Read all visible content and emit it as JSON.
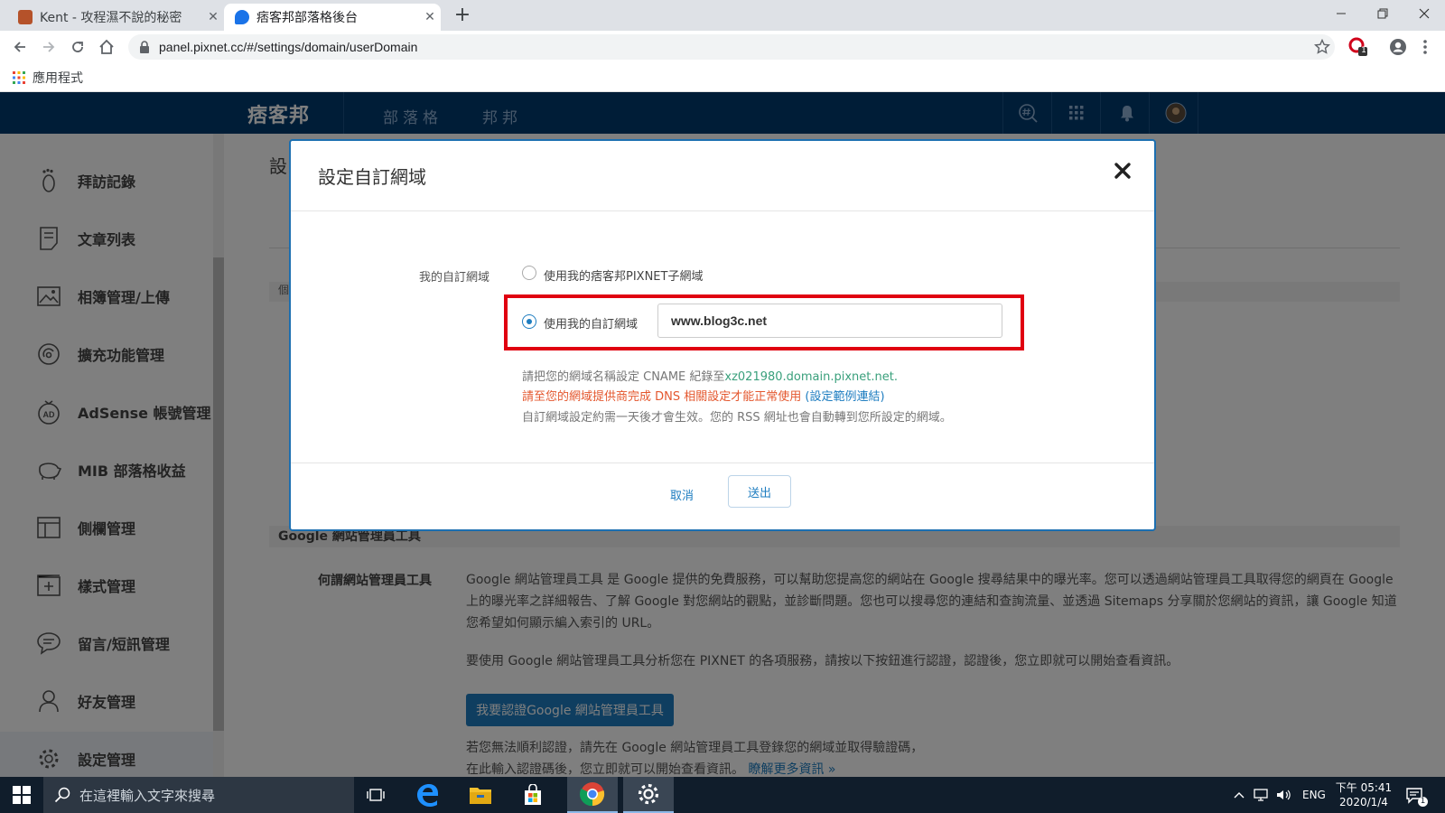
{
  "browser": {
    "tabs": [
      {
        "title": "Kent - 攻程濕不說的秘密",
        "favicon": "blog-favicon",
        "active": false
      },
      {
        "title": "痞客邦部落格後台",
        "favicon": "pixnet-favicon",
        "active": true
      }
    ],
    "url": "panel.pixnet.cc/#/settings/domain/userDomain",
    "bookmarks_label": "應用程式",
    "extension_badge": "1"
  },
  "site_header": {
    "logo": "痞客邦",
    "nav": [
      "部落格",
      "邦邦"
    ],
    "icons": [
      "search-hashtag-icon",
      "apps-grid-icon",
      "bell-icon",
      "avatar"
    ],
    "bg_color": "#003b6f"
  },
  "sidebar": {
    "items": [
      {
        "label": "拜訪記錄",
        "icon": "footprint-icon"
      },
      {
        "label": "文章列表",
        "icon": "document-icon"
      },
      {
        "label": "相簿管理/上傳",
        "icon": "image-icon"
      },
      {
        "label": "擴充功能管理",
        "icon": "plugin-icon"
      },
      {
        "label": "AdSense 帳號管理",
        "icon": "adsense-icon"
      },
      {
        "label": "MIB 部落格收益",
        "icon": "piggy-bank-icon"
      },
      {
        "label": "側欄管理",
        "icon": "sidebar-layout-icon"
      },
      {
        "label": "樣式管理",
        "icon": "style-icon"
      },
      {
        "label": "留言/短訊管理",
        "icon": "chat-icon"
      },
      {
        "label": "好友管理",
        "icon": "friend-icon"
      },
      {
        "label": "設定管理",
        "icon": "gear-icon",
        "active": true
      }
    ]
  },
  "main": {
    "title_partial": "設",
    "band_partial": "個",
    "google_section": "Google 網站管理員工具",
    "google_question": "何謂網站管理員工具",
    "google_desc": "Google 網站管理員工具 是 Google 提供的免費服務，可以幫助您提高您的網站在 Google 搜尋結果中的曝光率。您可以透過網站管理員工具取得您的網頁在 Google 上的曝光率之詳細報告、了解 Google 對您網站的觀點，並診斷問題。您也可以搜尋您的連結和查詢流量、並透過 Sitemaps 分享關於您網站的資訊，讓 Google 知道您希望如何顯示編入索引的 URL。",
    "google_usage": "要使用 Google 網站管理員工具分析您在 PIXNET 的各項服務，請按以下按鈕進行認證，認證後，您立即就可以開始查看資訊。",
    "google_button": "我要認證Google 網站管理員工具",
    "google_note1": "若您無法順利認證，請先在 Google 網站管理員工具登錄您的網域並取得驗證碼，",
    "google_note2": "在此輸入認證碼後，您立即就可以開始查看資訊。",
    "google_more": "瞭解更多資訊 »"
  },
  "modal": {
    "title": "設定自訂網域",
    "field_label": "我的自訂網域",
    "option_pixnet": "使用我的痞客邦PIXNET子網域",
    "option_custom": "使用我的自訂網域",
    "selected_option": "custom",
    "domain_value": "www.blog3c.net",
    "hint_cname_prefix": "請把您的網域名稱設定 CNAME 紀錄至",
    "hint_cname_target": "xz021980.domain.pixnet.net.",
    "hint_dns": "請至您的網域提供商完成 DNS 相關設定才能正常使用",
    "hint_dns_link": "(設定範例連結)",
    "hint_delay": "自訂網域設定約需一天後才會生效。您的 RSS 網址也會自動轉到您所設定的網域。",
    "cancel_label": "取消",
    "submit_label": "送出",
    "highlight_color": "#e00010",
    "accent_color": "#1e7dc0"
  },
  "taskbar": {
    "search_placeholder": "在這裡輸入文字來搜尋",
    "apps": [
      "task-view-icon",
      "edge-icon",
      "file-explorer-icon",
      "store-icon",
      "chrome-icon",
      "settings-icon"
    ],
    "language": "ENG",
    "time": "下午 05:41",
    "date": "2020/1/4",
    "notification_count": "1"
  }
}
